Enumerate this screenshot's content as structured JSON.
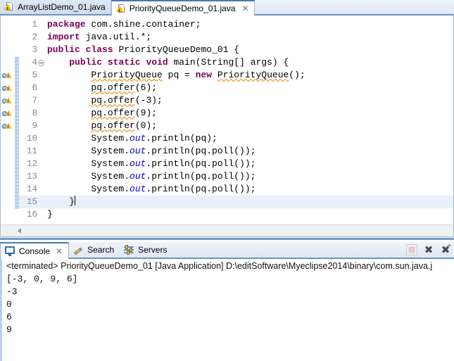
{
  "editor": {
    "tabs": [
      {
        "label": "ArrayListDemo_01.java",
        "icon": "java-file-warning-icon",
        "active": false,
        "closable": false
      },
      {
        "label": "PriorityQueueDemo_01.java",
        "icon": "java-file-warning-icon",
        "active": true,
        "closable": true,
        "close_glyph": "✕"
      }
    ],
    "line_numbers": [
      "1",
      "2",
      "3",
      "4",
      "5",
      "6",
      "7",
      "8",
      "9",
      "10",
      "11",
      "12",
      "13",
      "14",
      "15",
      "16"
    ],
    "current_line": 15,
    "fold_marker_line": 4,
    "warning_lines": [
      5,
      6,
      7,
      8,
      9
    ],
    "changebar_lines": [
      4,
      5,
      6,
      7,
      8,
      9,
      10,
      11,
      12,
      13,
      14,
      15
    ],
    "scrollbar": {
      "left_arrow_glyph": "◀"
    },
    "code": [
      {
        "n": "1",
        "tokens": [
          {
            "t": "package",
            "c": "kw"
          },
          {
            "t": " com.shine.container;",
            "c": ""
          }
        ]
      },
      {
        "n": "2",
        "tokens": [
          {
            "t": "import",
            "c": "kw"
          },
          {
            "t": " java.util.*;",
            "c": ""
          }
        ]
      },
      {
        "n": "3",
        "tokens": [
          {
            "t": "public",
            "c": "kw"
          },
          {
            "t": " ",
            "c": ""
          },
          {
            "t": "class",
            "c": "kw"
          },
          {
            "t": " PriorityQueueDemo_01 {",
            "c": ""
          }
        ]
      },
      {
        "n": "4",
        "tokens": [
          {
            "t": "    ",
            "c": ""
          },
          {
            "t": "public",
            "c": "kw"
          },
          {
            "t": " ",
            "c": ""
          },
          {
            "t": "static",
            "c": "kw"
          },
          {
            "t": " ",
            "c": ""
          },
          {
            "t": "void",
            "c": "kw"
          },
          {
            "t": " main(String[] args) {",
            "c": ""
          }
        ]
      },
      {
        "n": "5",
        "tokens": [
          {
            "t": "        ",
            "c": ""
          },
          {
            "t": "PriorityQueue",
            "c": "sq"
          },
          {
            "t": " pq = ",
            "c": ""
          },
          {
            "t": "new",
            "c": "kw"
          },
          {
            "t": " ",
            "c": ""
          },
          {
            "t": "PriorityQueue",
            "c": "sq"
          },
          {
            "t": "();",
            "c": ""
          }
        ]
      },
      {
        "n": "6",
        "tokens": [
          {
            "t": "        ",
            "c": ""
          },
          {
            "t": "pq.offer",
            "c": "sq"
          },
          {
            "t": "(6);",
            "c": ""
          }
        ]
      },
      {
        "n": "7",
        "tokens": [
          {
            "t": "        ",
            "c": ""
          },
          {
            "t": "pq.offer",
            "c": "sq"
          },
          {
            "t": "(-3);",
            "c": ""
          }
        ]
      },
      {
        "n": "8",
        "tokens": [
          {
            "t": "        ",
            "c": ""
          },
          {
            "t": "pq.offer",
            "c": "sq"
          },
          {
            "t": "(9);",
            "c": ""
          }
        ]
      },
      {
        "n": "9",
        "tokens": [
          {
            "t": "        ",
            "c": ""
          },
          {
            "t": "pq.offer",
            "c": "sq"
          },
          {
            "t": "(0);",
            "c": ""
          }
        ]
      },
      {
        "n": "10",
        "tokens": [
          {
            "t": "        System.",
            "c": ""
          },
          {
            "t": "out",
            "c": "fld"
          },
          {
            "t": ".println(pq);",
            "c": ""
          }
        ]
      },
      {
        "n": "11",
        "tokens": [
          {
            "t": "        System.",
            "c": ""
          },
          {
            "t": "out",
            "c": "fld"
          },
          {
            "t": ".println(pq.poll());",
            "c": ""
          }
        ]
      },
      {
        "n": "12",
        "tokens": [
          {
            "t": "        System.",
            "c": ""
          },
          {
            "t": "out",
            "c": "fld"
          },
          {
            "t": ".println(pq.poll());",
            "c": ""
          }
        ]
      },
      {
        "n": "13",
        "tokens": [
          {
            "t": "        System.",
            "c": ""
          },
          {
            "t": "out",
            "c": "fld"
          },
          {
            "t": ".println(pq.poll());",
            "c": ""
          }
        ]
      },
      {
        "n": "14",
        "tokens": [
          {
            "t": "        System.",
            "c": ""
          },
          {
            "t": "out",
            "c": "fld"
          },
          {
            "t": ".println(pq.poll());",
            "c": ""
          }
        ]
      },
      {
        "n": "15",
        "tokens": [
          {
            "t": "    }",
            "c": ""
          },
          {
            "t": "",
            "c": "caret"
          }
        ]
      },
      {
        "n": "16",
        "tokens": [
          {
            "t": "}",
            "c": ""
          }
        ]
      }
    ]
  },
  "console": {
    "tabs": [
      {
        "label": "Console",
        "icon": "console-monitor-icon",
        "active": true,
        "closable": true,
        "close_glyph": "✕"
      },
      {
        "label": "Search",
        "icon": "search-pencil-icon",
        "active": false,
        "closable": false
      },
      {
        "label": "Servers",
        "icon": "servers-sliders-icon",
        "active": false,
        "closable": false
      }
    ],
    "toolbar": [
      {
        "name": "terminate-button",
        "glyph": "",
        "kind": "stop-disabled"
      },
      {
        "name": "remove-launch-button",
        "glyph": "✖",
        "kind": "x"
      },
      {
        "name": "remove-all-terminated-button",
        "glyph": "✖",
        "kind": "x-sparkle",
        "spark_glyph": "✦"
      }
    ],
    "terminated_line": "<terminated> PriorityQueueDemo_01 [Java Application] D:\\editSoftware\\Myeclipse2014\\binary\\com.sun.java.j",
    "output": [
      "[-3, 0, 9, 6]",
      "-3",
      "0",
      "6",
      "9"
    ]
  },
  "colors": {
    "keyword": "#7f0055",
    "field": "#0000c0",
    "warning_squiggle": "#e8a33d",
    "tab_accent": "#4a78ab",
    "current_line": "#e8f0fc"
  }
}
